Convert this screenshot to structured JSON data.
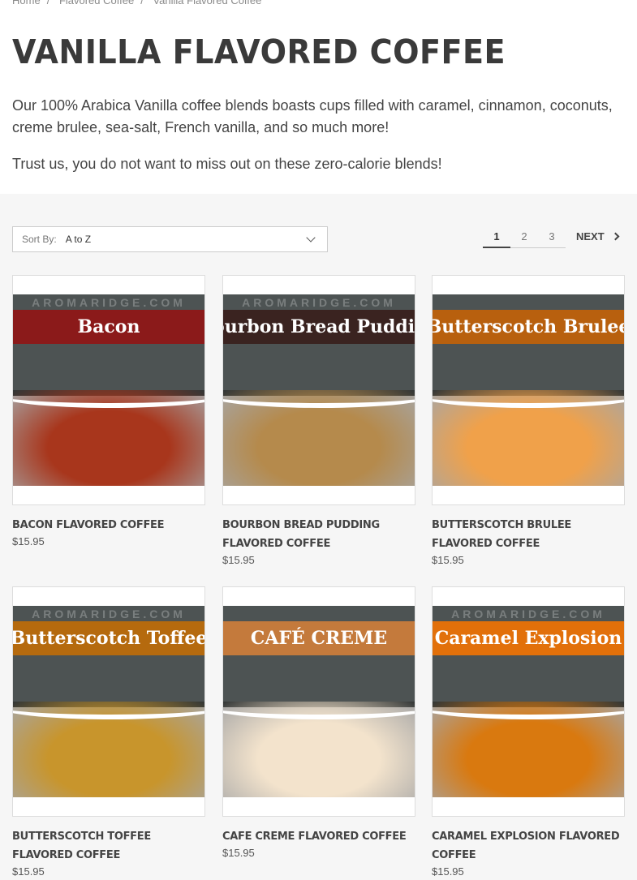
{
  "breadcrumb": [
    "Home",
    "Flavored Coffee",
    "Vanilla Flavored Coffee"
  ],
  "page_title": "VANILLA FLAVORED COFFEE",
  "description": "Our 100% Arabica Vanilla coffee blends boasts cups filled with caramel, cinnamon, coconuts, creme brulee, sea-salt, French vanilla, and so much more!",
  "description2": "Trust us, you do not want to miss out on these zero-calorie blends!",
  "sort": {
    "label": "Sort By:",
    "value": "A to Z"
  },
  "pagination": {
    "pages": [
      "1",
      "2",
      "3"
    ],
    "active": "1",
    "next_label": "NEXT"
  },
  "products": [
    {
      "name": "Bacon Flavored Coffee",
      "price": "$15.95",
      "banner": "Bacon",
      "banner_color": "#8b1a1a",
      "food_color": "#a8361c",
      "watermark": "AROMARIDGE.COM"
    },
    {
      "name": "Bourbon Bread Pudding Flavored Coffee",
      "price": "$15.95",
      "banner": "Bourbon Bread Pudding",
      "banner_color": "#3a2320",
      "food_color": "#b58a4c",
      "watermark": "AROMARIDGE.COM"
    },
    {
      "name": "Butterscotch Brulee Flavored Coffee",
      "price": "$15.95",
      "banner": "Butterscotch Brulee",
      "banner_color": "#b8600e",
      "food_color": "#f0a14a",
      "watermark": ""
    },
    {
      "name": "Butterscotch Toffee Flavored Coffee",
      "price": "$15.95",
      "banner": "Butterscotch Toffee",
      "banner_color": "#b56a0e",
      "food_color": "#c8952c",
      "watermark": "AROMARIDGE.COM"
    },
    {
      "name": "Cafe Creme Flavored Coffee",
      "price": "$15.95",
      "banner": "CAFÉ CREME",
      "banner_color": "#c47a3c",
      "food_color": "#f3e3cc",
      "watermark": ""
    },
    {
      "name": "Caramel Explosion Flavored Coffee",
      "price": "$15.95",
      "banner": "Caramel Explosion",
      "banner_color": "#e2700a",
      "food_color": "#d9790f",
      "watermark": "AROMARIDGE.COM"
    }
  ]
}
